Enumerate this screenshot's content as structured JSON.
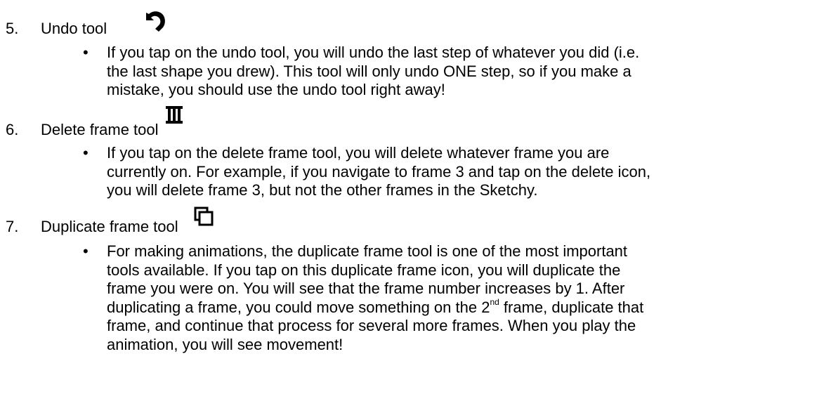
{
  "items": [
    {
      "number": "5.",
      "title": "Undo tool",
      "icon": "undo-icon",
      "bullet_lines": [
        "If you tap on the undo tool, you will undo the last step of whatever you did (i.e.",
        "the last shape you drew). This tool will only undo ONE step, so if you make a",
        "mistake, you should use the undo tool right away!"
      ]
    },
    {
      "number": "6.",
      "title": "Delete frame tool",
      "icon": "trash-icon",
      "bullet_lines": [
        "If you tap on the delete frame tool, you will delete whatever frame you are",
        "currently on. For example, if you navigate to frame 3 and tap on the delete icon,",
        "you will delete frame 3, but not the other frames in the Sketchy."
      ]
    },
    {
      "number": "7.",
      "title": "Duplicate frame tool",
      "icon": "duplicate-icon",
      "bullet_lines": [
        "For making animations, the duplicate frame tool is one of the most important",
        "tools available. If you tap on this duplicate frame icon, you will duplicate the",
        "frame you were on. You will see that the frame number increases by 1. After",
        "duplicating a frame, you could move something on the 2",
        "frame, and continue that process for several more frames. When you play the",
        "animation, you will see movement!"
      ],
      "superscript": "nd",
      "line4_rest": " frame, duplicate that"
    }
  ],
  "bullet_symbol": "•"
}
